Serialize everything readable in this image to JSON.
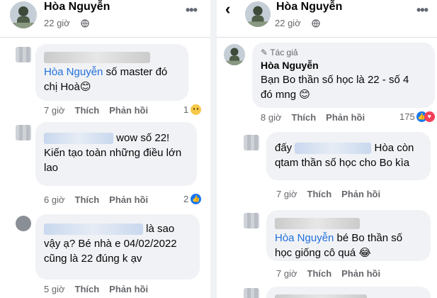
{
  "left": {
    "header": {
      "name": "Hòa Nguyễn",
      "time": "22 giờ",
      "menu": "•••"
    },
    "comments": [
      {
        "mention": "Hòa Nguyễn",
        "text_after_mention": " số master đó",
        "line2": "chị Hoà😊",
        "time": "7 giờ",
        "like": "Thích",
        "reply": "Phản hồi",
        "reaction_count": "1"
      },
      {
        "line1_after_blur": "wow số 22!",
        "line2": "Kiến tạo toàn những điều lớn",
        "line3": "lao",
        "time": "6 giờ",
        "like": "Thích",
        "reply": "Phản hồi",
        "reaction_count": "2"
      },
      {
        "line1_after_blur": "là sao",
        "line2": "vậy ạ? Bé nhà e 04/02/2022",
        "line3": "cũng là 22 đúng k ạv",
        "time": "5 giờ",
        "like": "Thích",
        "reply": "Phản hồi"
      }
    ]
  },
  "right": {
    "header": {
      "back": "‹",
      "name": "Hòa Nguyễn",
      "time": "22 giờ",
      "menu": "•••"
    },
    "author_comment": {
      "tag": "Tác giả",
      "name": "Hòa Nguyễn",
      "line1": "Bạn Bo thần số học là 22 - số 4",
      "line2": "đó mng 😊",
      "time": "8 giờ",
      "like": "Thích",
      "reply": "Phản hồi",
      "reaction_count": "175"
    },
    "reply1": {
      "line1_before_blur": "đấy",
      "line1_after_blur": "Hòa còn",
      "line2": "qtam thần số học cho Bo kìa",
      "time": "7 giờ",
      "like": "Thích",
      "reply": "Phản hồi"
    },
    "reply2": {
      "mention": "Hòa Nguyễn",
      "text_after_mention": " bé Bo thần số",
      "line2": "học giống cô quá 😂",
      "time": "7 giờ",
      "like": "Thích",
      "reply": "Phản hồi"
    }
  },
  "colors": {
    "mention": "#216fdb",
    "bubble": "#f0f2f5",
    "meta": "#65676b"
  }
}
